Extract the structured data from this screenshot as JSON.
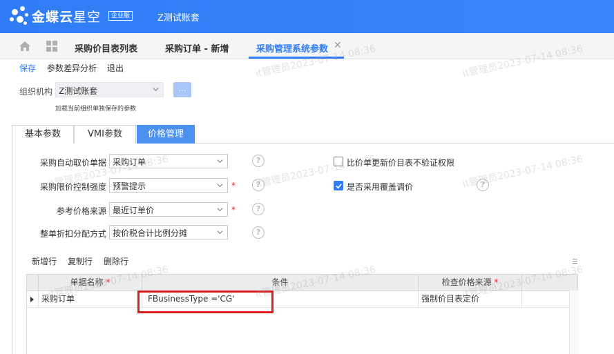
{
  "app": {
    "brand": "金蝶云",
    "brand_suffix": "星空",
    "edition": "企业版",
    "account": "Z测试账套"
  },
  "tabs": [
    {
      "label": "采购价目表列表"
    },
    {
      "label": "采购订单 - 新增"
    },
    {
      "label": "采购管理系统参数"
    }
  ],
  "toolbar": {
    "save": "保存",
    "diff": "参数差异分析",
    "exit": "退出"
  },
  "org": {
    "label": "组织机构",
    "value": "Z测试账套",
    "button": "...",
    "hint": "加载当前组织单独保存的参数"
  },
  "inner_tabs": [
    {
      "label": "基本参数"
    },
    {
      "label": "VMI参数"
    },
    {
      "label": "价格管理"
    }
  ],
  "form": {
    "auto_price_bill": {
      "label": "采购自动取价单据",
      "value": "采购订单"
    },
    "price_limit": {
      "label": "采购限价控制强度",
      "value": "预警提示"
    },
    "ref_price_source": {
      "label": "参考价格来源",
      "value": "最近订单价"
    },
    "discount_alloc": {
      "label": "整单折扣分配方式",
      "value": "按价税合计比例分摊"
    },
    "required_mark": "*",
    "help_mark": "?",
    "cb_no_verify": {
      "label": "比价单更新价目表不验证权限",
      "checked": false
    },
    "cb_overwrite": {
      "label": "是否采用覆盖调价",
      "checked": true
    }
  },
  "grid": {
    "toolbar": {
      "add": "新增行",
      "copy": "复制行",
      "delete": "删除行"
    },
    "headers": {
      "bill_name": "单据名称",
      "condition": "条件",
      "price_source": "检查价格来源",
      "required": "*"
    },
    "rows": [
      {
        "bill_name": "采购订单",
        "condition": "FBusinessType   ='CG'",
        "price_source": "强制价目表定价"
      }
    ]
  },
  "watermark": "it管理员2023-07-14 08:36",
  "colors": {
    "accent": "#2f7cf6",
    "highlight": "#d92020",
    "required": "#e02020"
  }
}
